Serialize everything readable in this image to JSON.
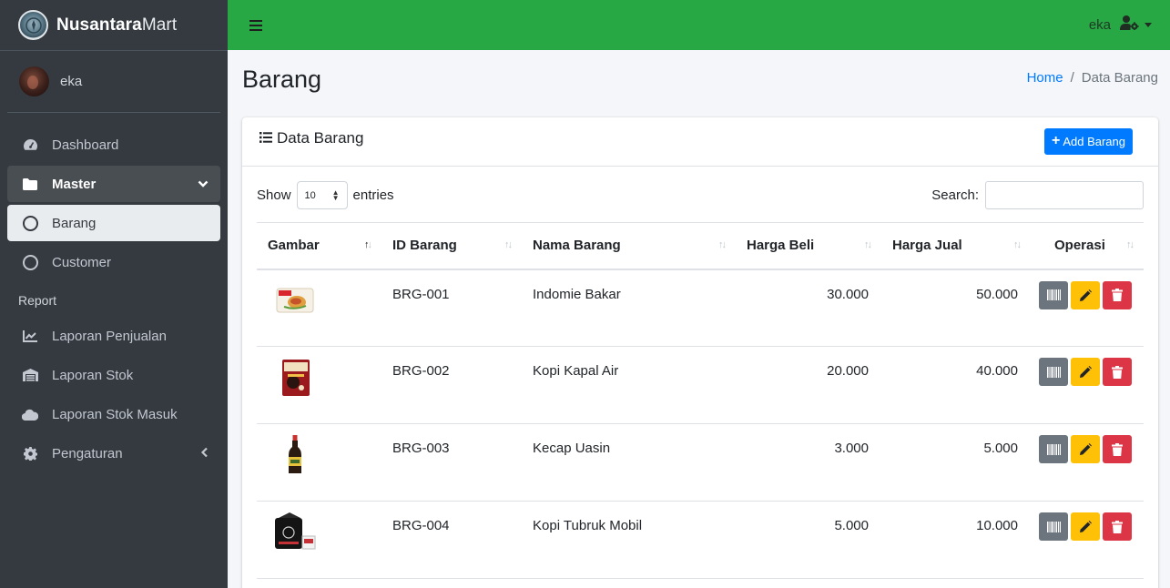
{
  "brand": {
    "name_bold": "Nusantara",
    "name_light": "Mart"
  },
  "user": {
    "name": "eka"
  },
  "sidebar": {
    "items": [
      {
        "label": "Dashboard"
      },
      {
        "label": "Master"
      },
      {
        "label": "Barang"
      },
      {
        "label": "Customer"
      }
    ],
    "report_header": "Report",
    "report_items": [
      {
        "label": "Laporan Penjualan"
      },
      {
        "label": "Laporan Stok"
      },
      {
        "label": "Laporan Stok Masuk"
      },
      {
        "label": "Pengaturan"
      }
    ]
  },
  "topbar": {
    "user_name": "eka"
  },
  "page": {
    "title": "Barang"
  },
  "breadcrumb": {
    "home": "Home",
    "separator": "/",
    "current": "Data Barang"
  },
  "card": {
    "title": "Data Barang",
    "add_button": "Add Barang"
  },
  "table_controls": {
    "show_label": "Show",
    "entries_value": "10",
    "entries_label": "entries",
    "search_label": "Search:"
  },
  "table": {
    "headers": [
      "Gambar",
      "ID Barang",
      "Nama Barang",
      "Harga Beli",
      "Harga Jual",
      "Operasi"
    ],
    "rows": [
      {
        "id": "BRG-001",
        "name": "Indomie Bakar",
        "buy": "30.000",
        "sell": "50.000"
      },
      {
        "id": "BRG-002",
        "name": "Kopi Kapal Air",
        "buy": "20.000",
        "sell": "40.000"
      },
      {
        "id": "BRG-003",
        "name": "Kecap Uasin",
        "buy": "3.000",
        "sell": "5.000"
      },
      {
        "id": "BRG-004",
        "name": "Kopi Tubruk Mobil",
        "buy": "5.000",
        "sell": "10.000"
      }
    ]
  },
  "colors": {
    "topbar": "#28a745",
    "sidebar": "#343a40",
    "primary": "#007bff",
    "warning": "#ffc107",
    "danger": "#dc3545",
    "secondary": "#6c757d"
  }
}
